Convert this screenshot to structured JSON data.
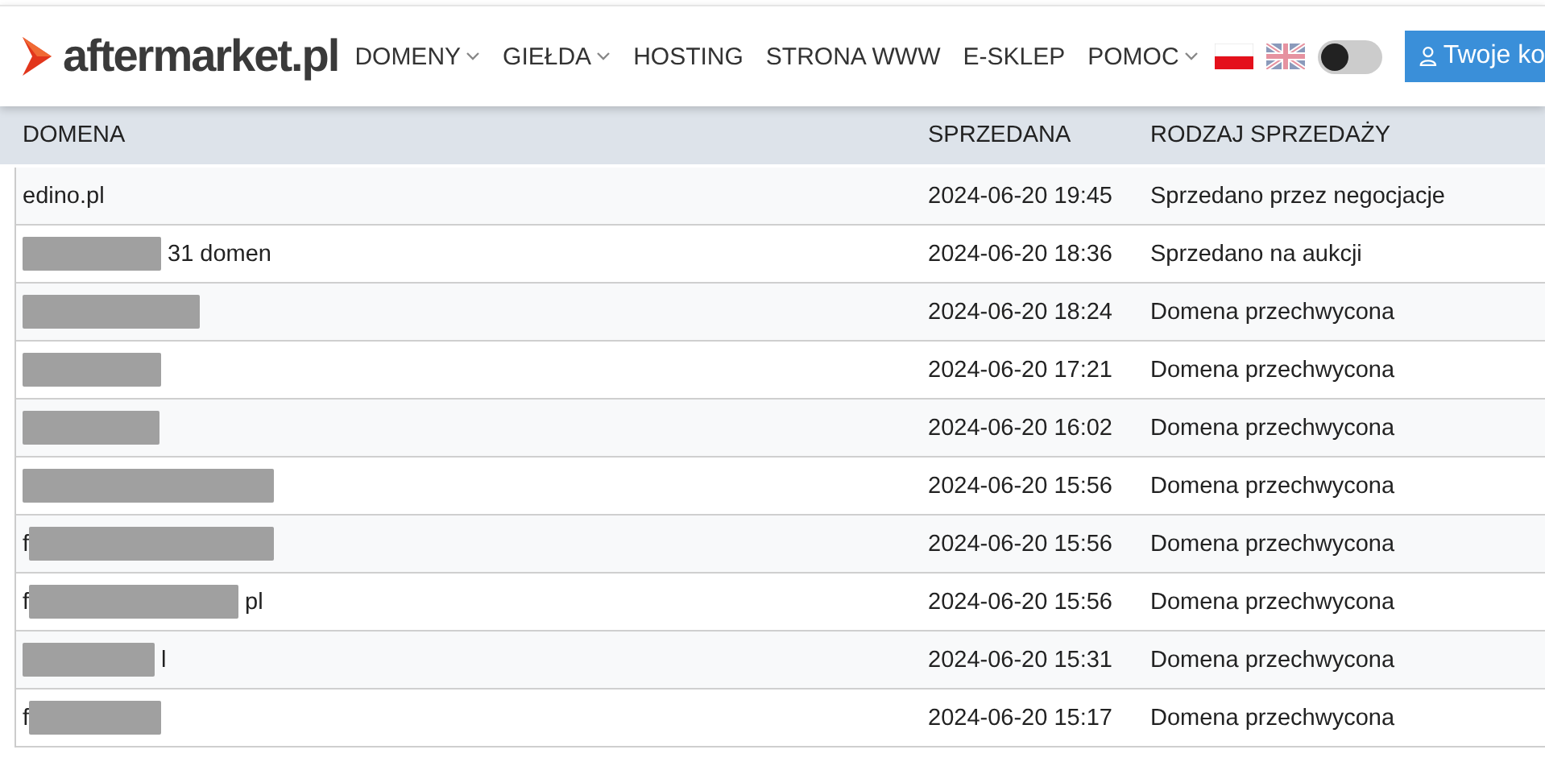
{
  "logo": {
    "text": "aftermarket.pl"
  },
  "nav": [
    {
      "label": "DOMENY",
      "dropdown": true
    },
    {
      "label": "GIEŁDA",
      "dropdown": true
    },
    {
      "label": "HOSTING",
      "dropdown": false
    },
    {
      "label": "STRONA WWW",
      "dropdown": false
    },
    {
      "label": "E-SKLEP",
      "dropdown": false
    },
    {
      "label": "POMOC",
      "dropdown": true
    }
  ],
  "languages": [
    {
      "kind": "pl",
      "selected": true
    },
    {
      "kind": "gb",
      "selected": false
    }
  ],
  "theme_toggle": {
    "on": false
  },
  "account_button": {
    "label": "Twoje ko"
  },
  "table": {
    "columns": [
      "DOMENA",
      "SPRZEDANA",
      "RODZAJ SPRZEDAŻY"
    ],
    "rows": [
      {
        "prefix": "edino.pl",
        "redacted": false,
        "suffix": "",
        "sold": "2024-06-20 19:45",
        "type": "Sprzedano przez negocjacje"
      },
      {
        "prefix": "",
        "redacted": true,
        "suffix": "31 domen",
        "sold": "2024-06-20 18:36",
        "type": "Sprzedano na aukcji"
      },
      {
        "prefix": "",
        "redacted": true,
        "suffix": "",
        "sold": "2024-06-20 18:24",
        "type": "Domena przechwycona"
      },
      {
        "prefix": "",
        "redacted": true,
        "suffix": "",
        "sold": "2024-06-20 17:21",
        "type": "Domena przechwycona"
      },
      {
        "prefix": "",
        "redacted": true,
        "suffix": "",
        "sold": "2024-06-20 16:02",
        "type": "Domena przechwycona"
      },
      {
        "prefix": "",
        "redacted": true,
        "suffix": "",
        "sold": "2024-06-20 15:56",
        "type": "Domena przechwycona"
      },
      {
        "prefix": "f",
        "redacted": true,
        "suffix": "",
        "sold": "2024-06-20 15:56",
        "type": "Domena przechwycona"
      },
      {
        "prefix": "f",
        "redacted": true,
        "suffix": "pl",
        "sold": "2024-06-20 15:56",
        "type": "Domena przechwycona"
      },
      {
        "prefix": "",
        "redacted": true,
        "suffix": "l",
        "sold": "2024-06-20 15:31",
        "type": "Domena przechwycona"
      },
      {
        "prefix": "f",
        "redacted": true,
        "suffix": "",
        "sold": "2024-06-20 15:17",
        "type": "Domena przechwycona"
      }
    ]
  }
}
